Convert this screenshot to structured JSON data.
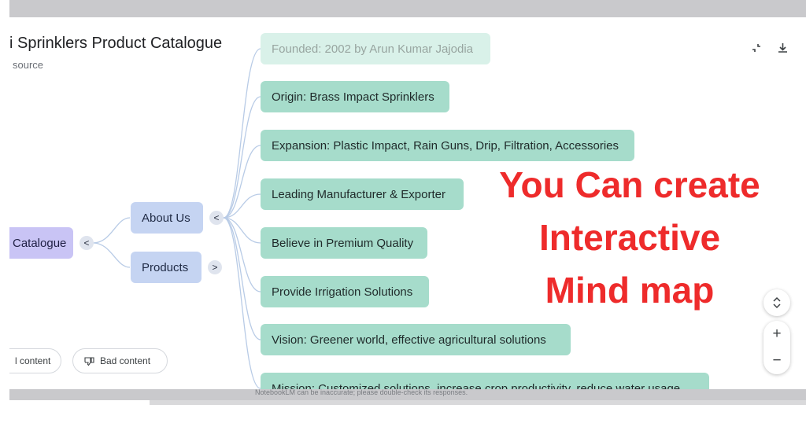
{
  "header": {
    "title": "i Sprinklers Product Catalogue",
    "subtitle": "source"
  },
  "toolbar": {
    "collapse_icon": "collapse-icon",
    "download_icon": "download-icon"
  },
  "mindmap": {
    "root": {
      "label": "Catalogue",
      "toggle": "<"
    },
    "branches": [
      {
        "label": "About Us",
        "toggle": "<"
      },
      {
        "label": "Products",
        "toggle": ">"
      }
    ],
    "children": [
      "Founded: 2002 by Arun Kumar Jajodia",
      "Origin: Brass Impact Sprinklers",
      "Expansion: Plastic Impact, Rain Guns, Drip, Filtration, Accessories",
      "Leading Manufacturer & Exporter",
      "Believe in Premium Quality",
      "Provide Irrigation Solutions",
      "Vision: Greener world, effective agricultural solutions",
      "Mission: Customized solutions, increase crop productivity, reduce water usage"
    ]
  },
  "overlay": {
    "lines": [
      "You Can create",
      "Interactive",
      "Mind map"
    ],
    "color": "#ee2b2b"
  },
  "feedback": {
    "good_label": "l content",
    "bad_label": "Bad content"
  },
  "controls": {
    "expand_icon": "expand-collapse-icon",
    "zoom_in": "+",
    "zoom_out": "−"
  },
  "footer": {
    "disclaimer": "NotebookLM can be inaccurate; please double-check its responses."
  }
}
